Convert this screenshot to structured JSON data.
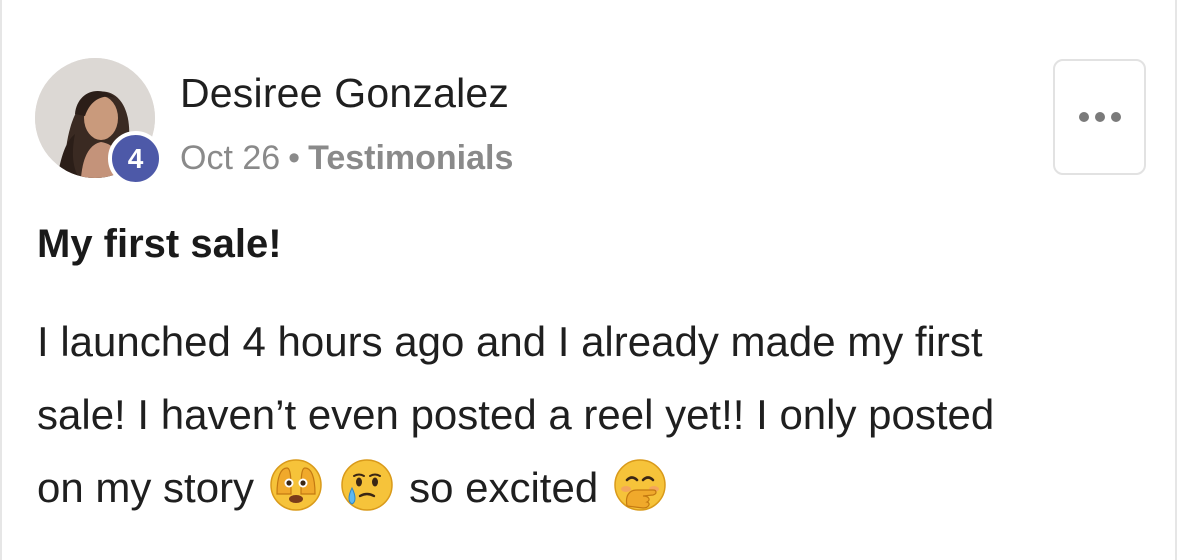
{
  "post": {
    "author": {
      "name": "Desiree Gonzalez",
      "level": "4"
    },
    "date": "Oct 26",
    "separator": "•",
    "category": "Testimonials",
    "title": "My first sale!",
    "body": {
      "line1": "I launched 4 hours ago and I already made my first",
      "line2": "sale! I haven’t even posted a reel yet!! I only posted",
      "line3_start": "on my story",
      "line3_end": "so excited"
    },
    "emojis": [
      "face-with-peeking-eye-emoji",
      "face-holding-back-tears-emoji",
      "face-with-hand-over-mouth-emoji"
    ]
  },
  "colors": {
    "badge": "#4d59a8",
    "meta_text": "#8a8a8a",
    "text": "#1f1f1f"
  }
}
